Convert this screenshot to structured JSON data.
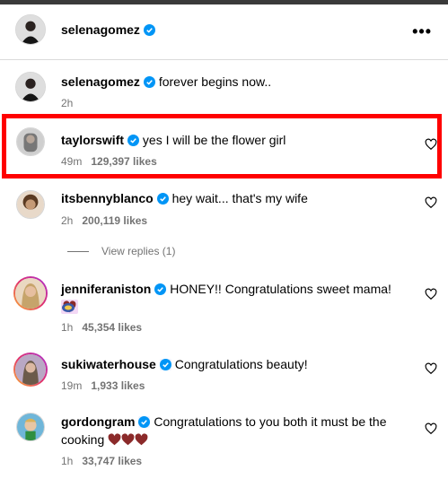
{
  "post": {
    "author": "selenagomez",
    "more_label": "•••"
  },
  "caption": {
    "username": "selenagomez",
    "text": "forever begins now..",
    "time": "2h"
  },
  "comments": [
    {
      "username": "taylorswift",
      "text": "yes I will be the flower girl",
      "time": "49m",
      "likes": "129,397 likes"
    },
    {
      "username": "itsbennyblanco",
      "text": "hey wait... that's my wife",
      "time": "2h",
      "likes": "200,119 likes"
    },
    {
      "username": "jenniferaniston",
      "text": "HONEY!! Congratulations sweet mama!",
      "time": "1h",
      "likes": "45,354 likes"
    },
    {
      "username": "sukiwaterhouse",
      "text": "Congratulations beauty!",
      "time": "19m",
      "likes": "1,933 likes"
    },
    {
      "username": "gordongram",
      "text": "Congratulations to you both it must be the",
      "text2": "cooking",
      "time": "1h",
      "likes": "33,747 likes"
    }
  ],
  "view_replies": "View replies (1)",
  "colors": {
    "verified": "#0095f6",
    "highlight": "#ff0000",
    "meta": "#737373"
  }
}
